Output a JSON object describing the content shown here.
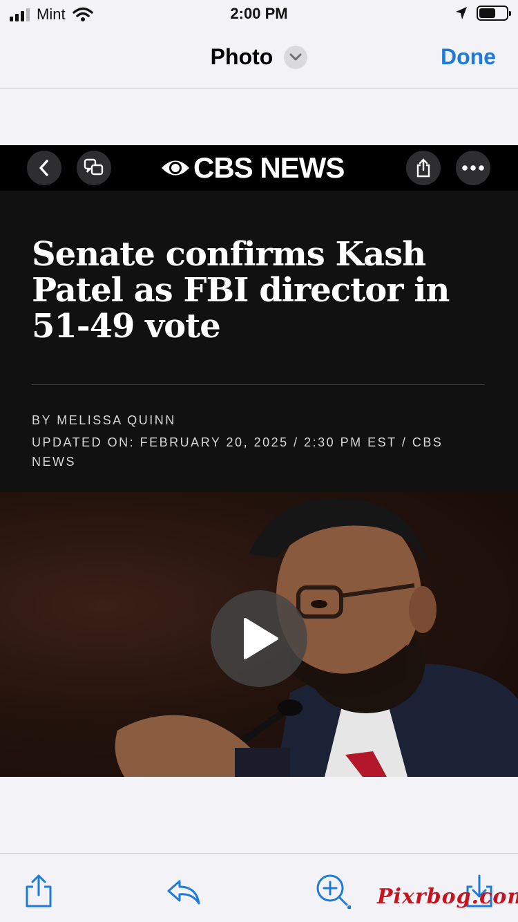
{
  "status_bar": {
    "carrier": "Mint",
    "time": "2:00 PM",
    "signal_bars": 3,
    "battery_level": 0.6
  },
  "nav": {
    "title": "Photo",
    "done_label": "Done",
    "accent": "#1e7ad8"
  },
  "screenshot": {
    "brand": "CBS NEWS",
    "headline": "Senate confirms Kash Patel as FBI director in 51-49 vote",
    "byline": "BY MELISSA QUINN",
    "updated": "UPDATED ON:  FEBRUARY 20, 2025 / 2:30 PM EST / CBS NEWS",
    "icons": [
      "back-icon",
      "translate-icon",
      "share-icon",
      "more-icon",
      "play-icon"
    ]
  },
  "toolbar": {
    "icons": [
      "share-icon",
      "reply-icon",
      "zoom-icon",
      "save-icon"
    ]
  },
  "watermark": "Pixrbog.com"
}
